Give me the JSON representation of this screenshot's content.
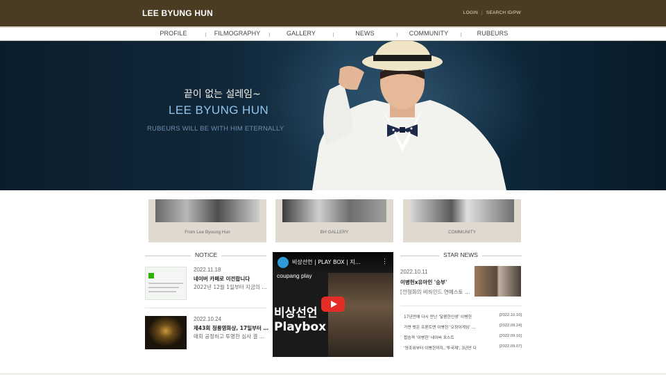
{
  "header": {
    "logo": "LEE BYUNG HUN",
    "login": "LOGIN",
    "search": "SEARCH ID/PW"
  },
  "nav": {
    "items": [
      "PROFILE",
      "FILMOGRAPHY",
      "GALLERY",
      "NEWS",
      "COMMUNITY",
      "RUBEURS"
    ]
  },
  "hero": {
    "korean": "끝이 없는 설레임~",
    "name": "LEE BYUNG HUN",
    "tagline": "RUBEURS WILL BE WITH HIM ETERNALLY"
  },
  "quick_links": [
    {
      "label": "From Lee Byoung Hun"
    },
    {
      "label": "BH GALLERY"
    },
    {
      "label": "COMMUNITY"
    }
  ],
  "notice": {
    "title": "NOTICE",
    "items": [
      {
        "date": "2022.11.18",
        "title": "네이버 카페로 이전합니다",
        "desc": "2022년 12월 1일부터 지금의 …"
      },
      {
        "date": "2022.10.24",
        "title": "제43회 청룡영화상, 17일부터 …",
        "desc": "매회 공정하고 투명한 심사 결 …"
      }
    ]
  },
  "video": {
    "title": "비상선언 | PLAY BOX | 지…",
    "brand": "coupang play",
    "overlay_line1": "비상선언",
    "overlay_line2": "Playbox",
    "menu_icon": "⋮"
  },
  "star_news": {
    "title": "STAR NEWS",
    "feature": {
      "date": "2022.10.11",
      "title": "이병헌x유아인 '승부'",
      "desc": "[전형화의 비하인드 연예스토 …"
    },
    "items": [
      {
        "title": "17년만에 다시 만난 '달콤한인생' 이병헌",
        "date": "[2022.10.10]"
      },
      {
        "title": "가면 벗은 프론트맨 이병헌 '오징어게임' …",
        "date": "[2022.09.24]"
      },
      {
        "title": "합승객 '이병헌' 네이버 포스트",
        "date": "[2022.09.16]"
      },
      {
        "title": "'양조위부터 이병헌까지..'투국제'; 3년만 다",
        "date": "[2022.09.07]"
      }
    ]
  },
  "colors": {
    "topbar": "#4a3c22",
    "hero_name": "#8fc4ef",
    "box_bg": "#dfd9d0",
    "play": "#e52d27"
  }
}
